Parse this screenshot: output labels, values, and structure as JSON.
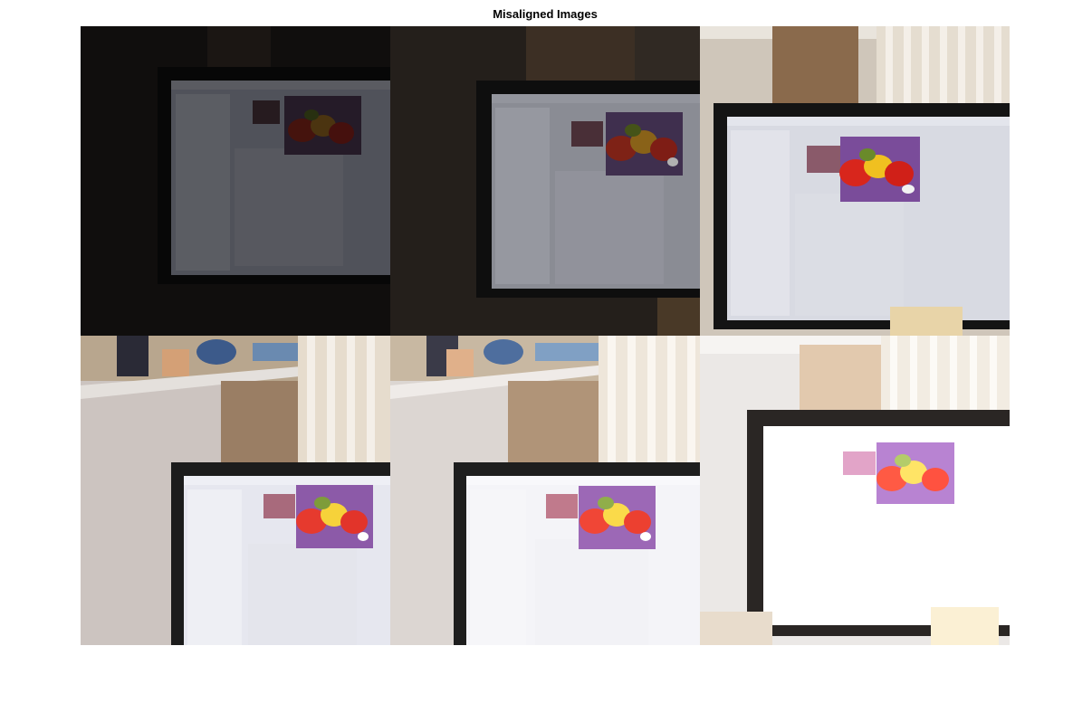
{
  "figure": {
    "title": "Misaligned Images"
  },
  "montage": {
    "rows": 2,
    "columns": 3,
    "tiles": [
      {
        "exposure": "very-dark"
      },
      {
        "exposure": "dark"
      },
      {
        "exposure": "normal"
      },
      {
        "exposure": "bright"
      },
      {
        "exposure": "brighter"
      },
      {
        "exposure": "overexposed"
      }
    ]
  },
  "colors": {
    "background": "#ffffff",
    "title_text": "#000000",
    "monitor_bezel": "#1c1c1c",
    "screen": "#e8e8ee",
    "photo_purple": "#7a4c9a",
    "pepper_red": "#d8261c",
    "pepper_yellow": "#f0c020",
    "pepper_green": "#6a8a2a",
    "wall": "#c9bfb2",
    "blinds": "#e6dccd"
  }
}
